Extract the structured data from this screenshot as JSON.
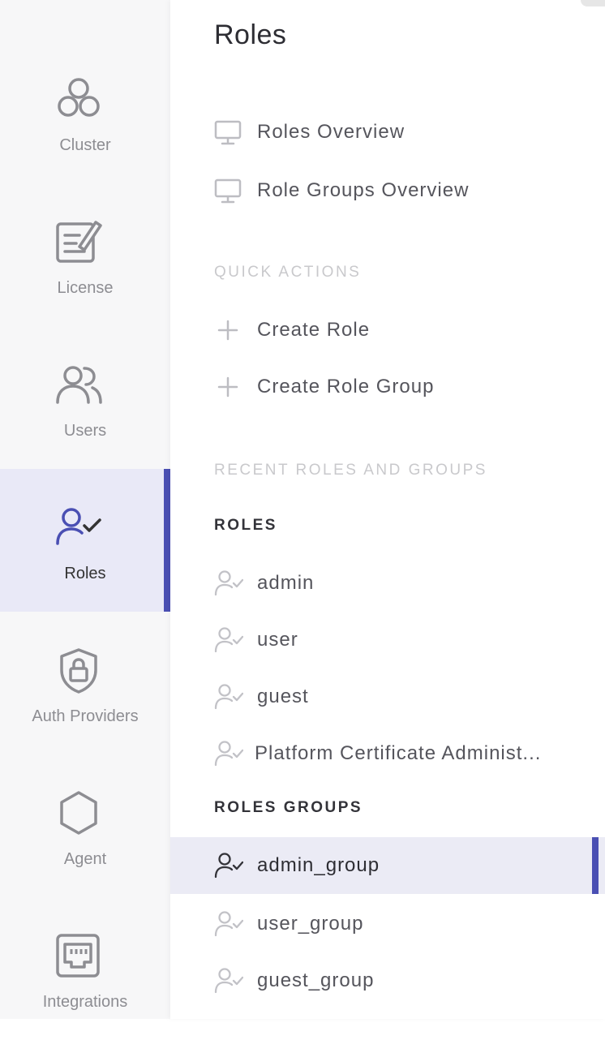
{
  "rail": {
    "items": [
      {
        "label": "Cluster",
        "icon": "cluster-icon"
      },
      {
        "label": "License",
        "icon": "license-icon"
      },
      {
        "label": "Users",
        "icon": "users-icon"
      },
      {
        "label": "Roles",
        "icon": "roles-icon",
        "active": true
      },
      {
        "label": "Auth Providers",
        "icon": "shield-lock-icon"
      },
      {
        "label": "Agent",
        "icon": "hexagon-icon"
      },
      {
        "label": "Integrations",
        "icon": "ethernet-port-icon"
      }
    ]
  },
  "panel": {
    "title": "Roles",
    "overview": [
      {
        "label": "Roles Overview",
        "icon": "monitor-icon"
      },
      {
        "label": "Role Groups Overview",
        "icon": "monitor-icon"
      }
    ],
    "quick_actions_heading": "QUICK ACTIONS",
    "quick_actions": [
      {
        "label": "Create Role",
        "icon": "plus-icon"
      },
      {
        "label": "Create Role Group",
        "icon": "plus-icon"
      }
    ],
    "recent_heading": "RECENT ROLES AND GROUPS",
    "roles_heading": "ROLES",
    "roles": [
      {
        "label": "admin"
      },
      {
        "label": "user"
      },
      {
        "label": "guest"
      },
      {
        "label": "Platform Certificate Administ..."
      }
    ],
    "role_groups_heading": "ROLES GROUPS",
    "role_groups": [
      {
        "label": "admin_group",
        "active": true
      },
      {
        "label": "user_group"
      },
      {
        "label": "guest_group"
      }
    ]
  },
  "colors": {
    "accent": "#4a4fb3",
    "active_bg": "#e9e9f7",
    "muted_text": "#8d8d92"
  }
}
